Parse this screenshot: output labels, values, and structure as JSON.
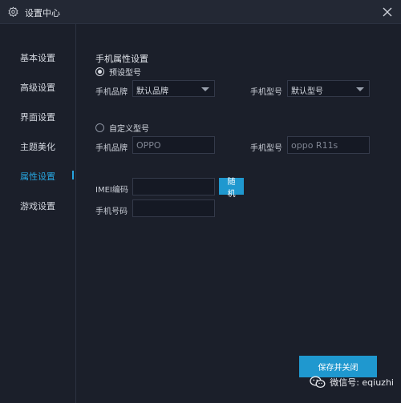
{
  "window": {
    "title": "设置中心",
    "icons": {
      "title": "gear-icon",
      "close": "close-icon"
    }
  },
  "sidebar": {
    "items": [
      {
        "label": "基本设置",
        "active": false
      },
      {
        "label": "高级设置",
        "active": false
      },
      {
        "label": "界面设置",
        "active": false
      },
      {
        "label": "主题美化",
        "active": false
      },
      {
        "label": "属性设置",
        "active": true
      },
      {
        "label": "游戏设置",
        "active": false
      }
    ]
  },
  "main": {
    "section_title": "手机属性设置",
    "preset": {
      "radio_label": "预设型号",
      "selected": true,
      "brand_label": "手机品牌",
      "brand_value": "默认品牌",
      "model_label": "手机型号",
      "model_value": "默认型号"
    },
    "custom": {
      "radio_label": "自定义型号",
      "selected": false,
      "brand_label": "手机品牌",
      "brand_value": "OPPO",
      "model_label": "手机型号",
      "model_value": "oppo R11s"
    },
    "imei": {
      "label": "IMEI编码",
      "value": "",
      "random_button": "随机"
    },
    "phone": {
      "label": "手机号码",
      "value": ""
    },
    "save_button": "保存并关闭"
  },
  "watermark": {
    "text": "微信号: eqiuzhi",
    "icon": "wechat-icon"
  },
  "colors": {
    "background": "#1b1f2a",
    "titlebar": "#232834",
    "accent": "#1f98cf",
    "active_text": "#27a5df"
  }
}
